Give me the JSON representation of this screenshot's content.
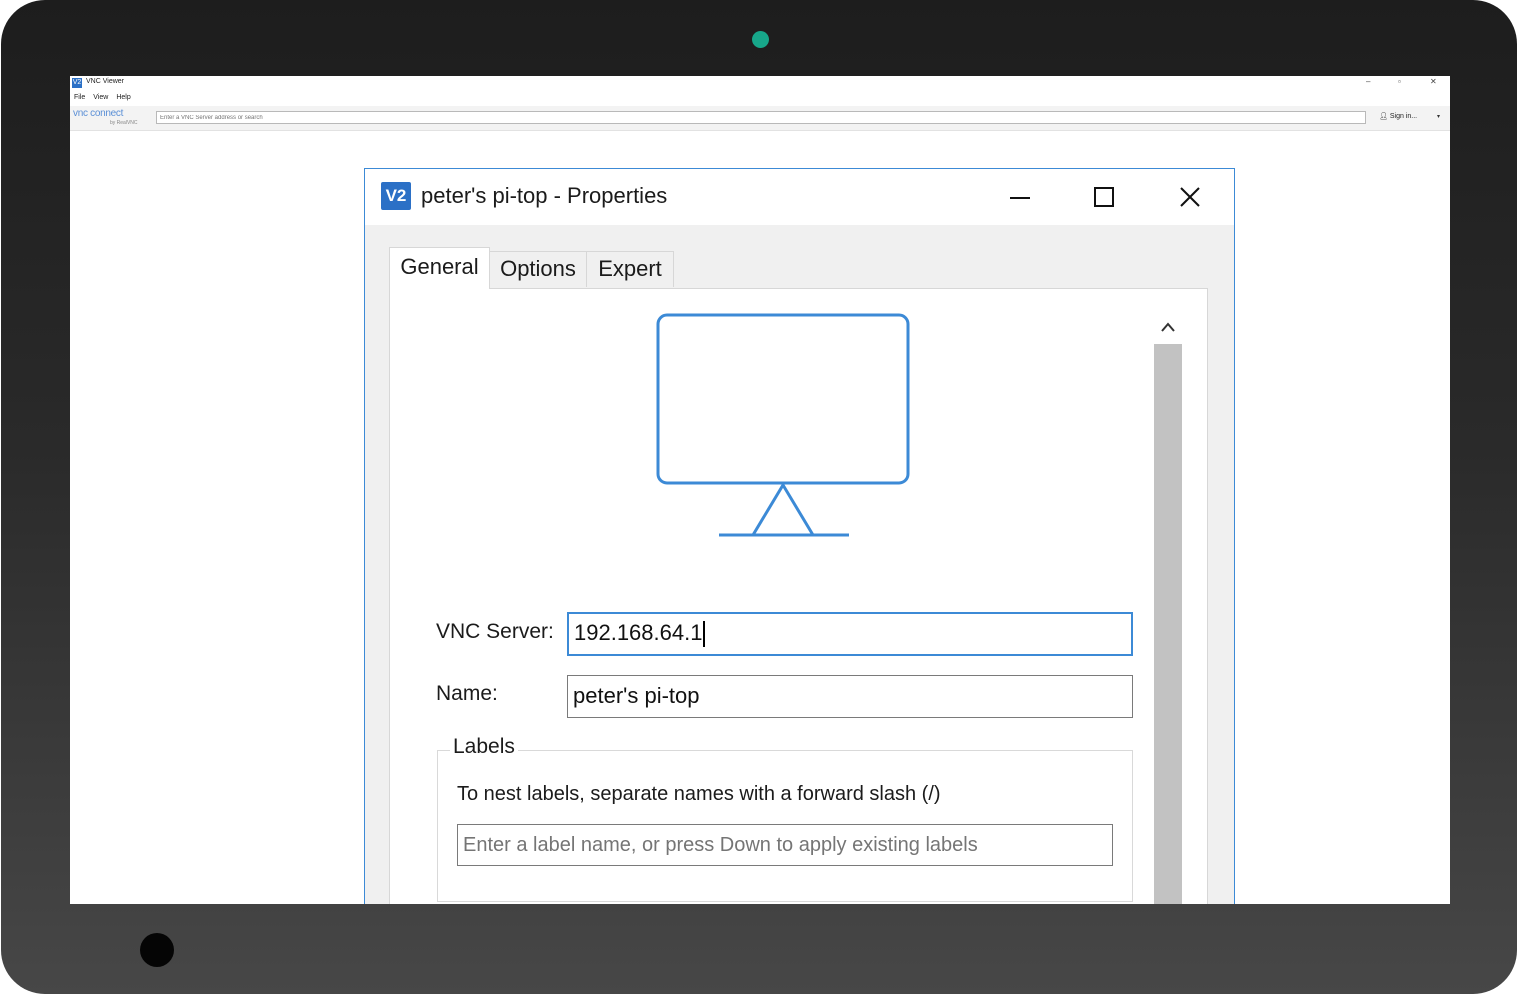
{
  "main_window": {
    "title": "VNC Viewer",
    "window_controls": {
      "minimize": "–",
      "maximize": "▫",
      "close": "✕"
    },
    "menu": [
      "File",
      "View",
      "Help"
    ],
    "logo": {
      "text": "vnc connect",
      "sub": "by RealVNC"
    },
    "search": {
      "placeholder": "Enter a VNC Server address or search"
    },
    "sign_in": {
      "label": "Sign in...",
      "arrow": "▾"
    },
    "app_icon": "V2"
  },
  "dialog": {
    "title": "peter's pi-top - Properties",
    "app_icon": "V2",
    "tabs": [
      {
        "label": "General",
        "active": true
      },
      {
        "label": "Options",
        "active": false
      },
      {
        "label": "Expert",
        "active": false
      }
    ],
    "preview_icon": "monitor-icon",
    "fields": {
      "vnc_server": {
        "label": "VNC Server:",
        "value": "192.168.64.1"
      },
      "name": {
        "label": "Name:",
        "value": "peter's pi-top"
      }
    },
    "labels": {
      "legend": "Labels",
      "hint": "To nest labels, separate names with a forward slash (/)",
      "placeholder": "Enter a label name, or press Down to apply existing labels"
    }
  },
  "colors": {
    "accent": "#3c8ad6",
    "app_icon": "#2b70c6",
    "camera_indicator": "#17a78a",
    "frame": "#262626"
  }
}
